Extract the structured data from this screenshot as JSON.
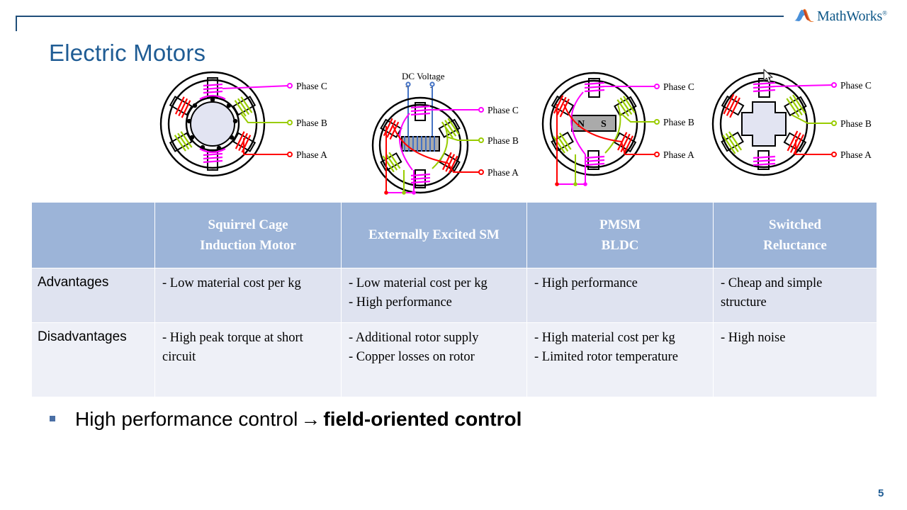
{
  "logo": {
    "name": "MathWorks",
    "trademark": "®"
  },
  "slide": {
    "title": "Electric Motors",
    "page_number": "5"
  },
  "diagrams": [
    {
      "id": "squirrel-cage-induction-motor-diagram",
      "type": "cage-rotor",
      "dc_label": "",
      "rotor_label": "",
      "phase_labels": [
        "Phase C",
        "Phase B",
        "Phase A"
      ]
    },
    {
      "id": "externally-excited-sm-diagram",
      "type": "wound-rotor",
      "dc_label": "DC Voltage",
      "dc_plus": "+",
      "dc_minus": "-",
      "rotor_label": "",
      "phase_labels": [
        "Phase C",
        "Phase B",
        "Phase A"
      ]
    },
    {
      "id": "pmsm-bldc-diagram",
      "type": "magnet-rotor",
      "dc_label": "",
      "rotor_label_n": "N",
      "rotor_label_s": "S",
      "phase_labels": [
        "Phase C",
        "Phase B",
        "Phase A"
      ]
    },
    {
      "id": "switched-reluctance-diagram",
      "type": "salient-rotor",
      "dc_label": "",
      "rotor_label": "",
      "phase_labels": [
        "Phase C",
        "Phase B",
        "Phase A"
      ]
    }
  ],
  "colors": {
    "title": "#1f5c94",
    "header_fill": "#9cb4d8",
    "row_advantages": "#dfe3f0",
    "row_disadvantages": "#eef0f7",
    "phase_a": "#ff0000",
    "phase_b": "#99cc00",
    "phase_c": "#ff00ff",
    "dc_wire": "#4472c4",
    "bullet": "#4a6fa5"
  },
  "table": {
    "headers": {
      "corner": "",
      "col1_line1": "Squirrel Cage",
      "col1_line2": "Induction Motor",
      "col2_line1": "Externally Excited SM",
      "col2_line2": "",
      "col3_line1": "PMSM",
      "col3_line2": "BLDC",
      "col4_line1": "Switched",
      "col4_line2": "Reluctance"
    },
    "rows": [
      {
        "label": "Advantages",
        "cells": [
          [
            "- Low material cost per kg"
          ],
          [
            "- Low material cost per kg",
            "- High performance"
          ],
          [
            "- High performance"
          ],
          [
            "- Cheap and simple structure"
          ]
        ]
      },
      {
        "label": "Disadvantages",
        "cells": [
          [
            "- High peak torque at short circuit"
          ],
          [
            "- Additional rotor supply",
            "- Copper losses on rotor"
          ],
          [
            "- High material cost per kg",
            "- Limited rotor temperature"
          ],
          [
            "- High noise"
          ]
        ]
      }
    ]
  },
  "bullet": {
    "text_before": "High performance control",
    "arrow": "→",
    "text_bold": "field-oriented control"
  }
}
